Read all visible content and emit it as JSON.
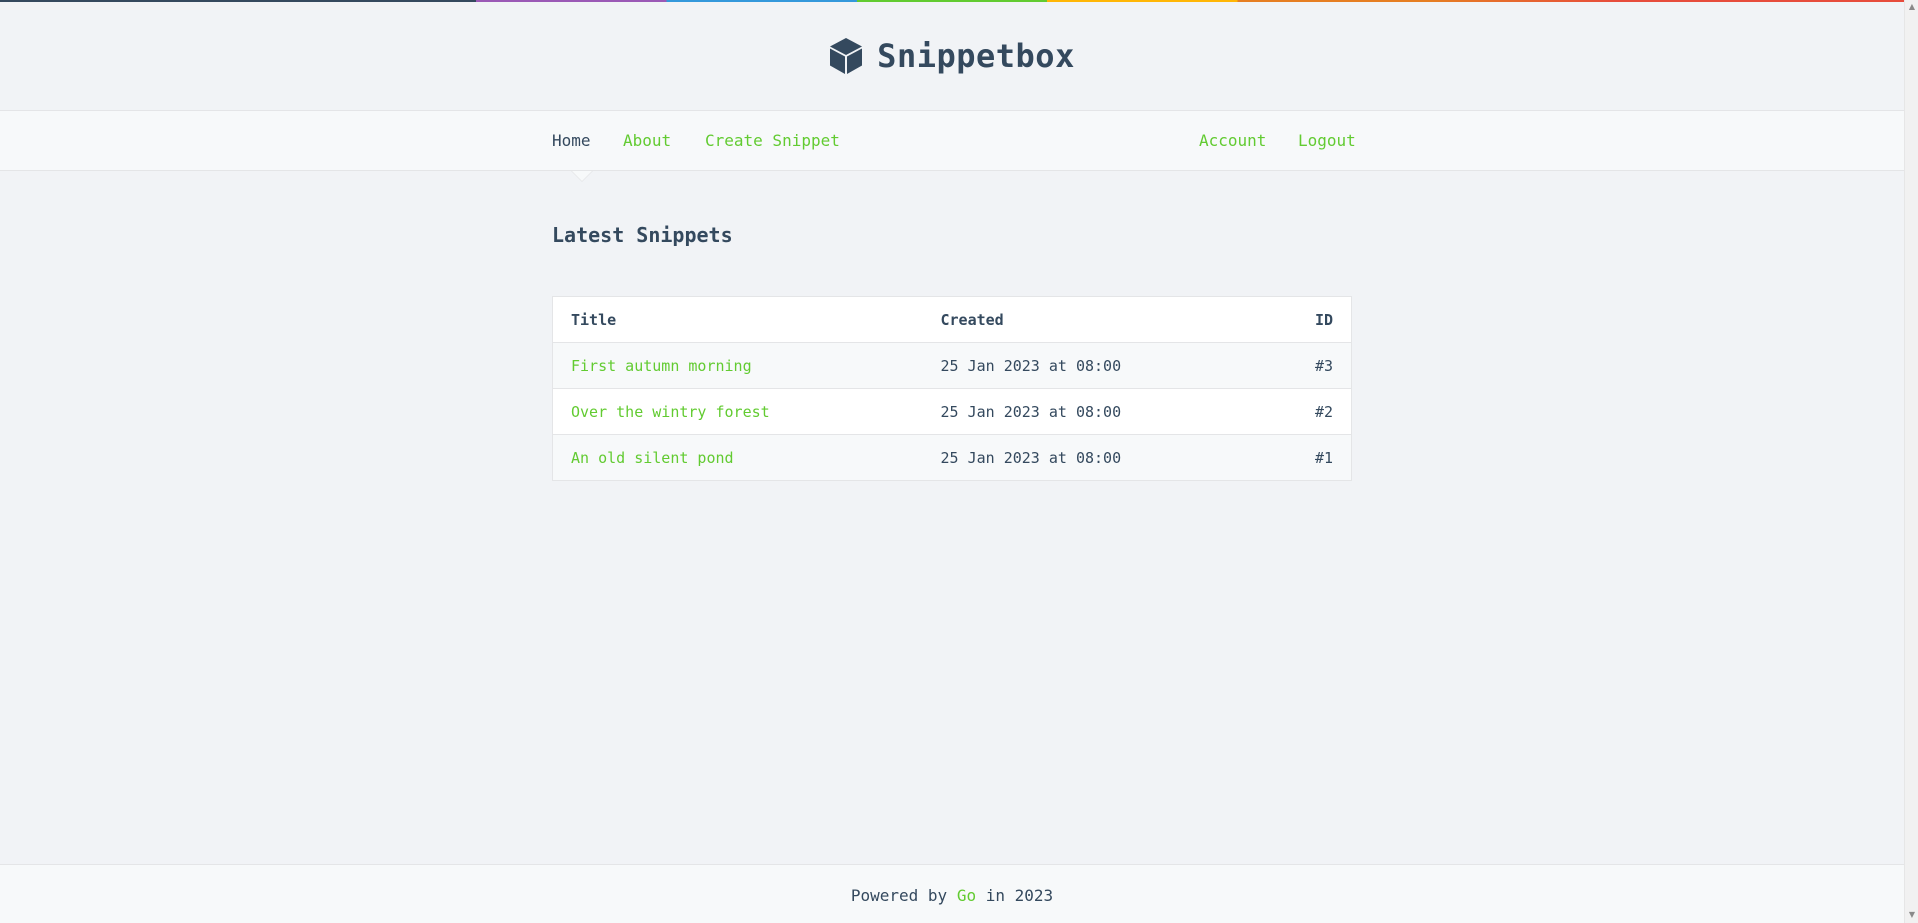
{
  "header": {
    "brand": "Snippetbox",
    "logo_icon": "cube-icon"
  },
  "nav": {
    "left": [
      {
        "label": "Home"
      },
      {
        "label": "About"
      },
      {
        "label": "Create Snippet"
      }
    ],
    "right": [
      {
        "label": "Account"
      },
      {
        "label": "Logout"
      }
    ]
  },
  "main": {
    "heading": "Latest Snippets",
    "table": {
      "headers": {
        "title": "Title",
        "created": "Created",
        "id": "ID"
      },
      "rows": [
        {
          "title": "First autumn morning",
          "created": "25 Jan 2023 at 08:00",
          "id": "#3"
        },
        {
          "title": "Over the wintry forest",
          "created": "25 Jan 2023 at 08:00",
          "id": "#2"
        },
        {
          "title": "An old silent pond",
          "created": "25 Jan 2023 at 08:00",
          "id": "#1"
        }
      ]
    }
  },
  "footer": {
    "prefix": "Powered by",
    "link": "Go",
    "suffix": "in 2023"
  },
  "colors": {
    "text": "#34495e",
    "link": "#62cb31",
    "background": "#f1f3f6",
    "surface": "#f7f9fa"
  }
}
